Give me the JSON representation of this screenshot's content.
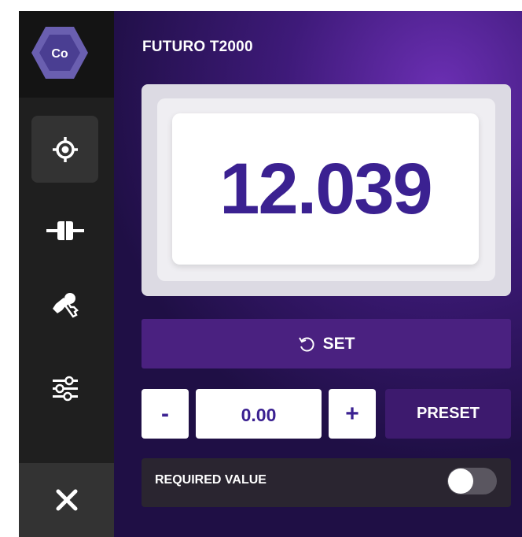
{
  "logo": {
    "text": "Co"
  },
  "sidebar": {
    "items": [
      {
        "name": "target",
        "icon": "crosshair-icon",
        "active": true
      },
      {
        "name": "connector",
        "icon": "plug-icon",
        "active": false
      },
      {
        "name": "keys",
        "icon": "keys-icon",
        "active": false
      },
      {
        "name": "settings",
        "icon": "sliders-icon",
        "active": false
      }
    ],
    "close_icon": "close-icon"
  },
  "header": {
    "title": "FUTURO T2000"
  },
  "display": {
    "value": "12.039"
  },
  "set_button": {
    "label": "SET",
    "icon": "reset-icon"
  },
  "stepper": {
    "minus_label": "-",
    "value": "0.00",
    "plus_label": "+"
  },
  "preset_button": {
    "label": "PRESET"
  },
  "required_value": {
    "label": "REQUIRED VALUE",
    "enabled": false
  },
  "colors": {
    "accent": "#3b2191",
    "button_purple": "#4a2180",
    "sidebar": "#1f1f1f"
  }
}
